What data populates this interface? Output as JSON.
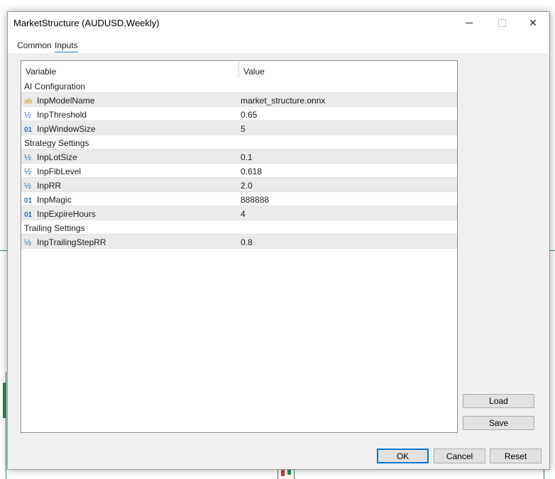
{
  "window": {
    "title": "MarketStructure (AUDUSD,Weekly)",
    "minimize_glyph": "—",
    "maximize_glyph": "□",
    "close_glyph": "✕"
  },
  "tabs": [
    {
      "label": "Common",
      "active": false
    },
    {
      "label": "Inputs",
      "active": true
    }
  ],
  "grid": {
    "headers": {
      "variable": "Variable",
      "value": "Value"
    },
    "rows": [
      {
        "kind": "section",
        "variable": "AI Configuration",
        "value": ""
      },
      {
        "kind": "param",
        "type_icon": "ab",
        "icon_name": "string-type-icon",
        "variable": "InpModelName",
        "value": "market_structure.onnx"
      },
      {
        "kind": "param",
        "type_icon": "½",
        "icon_name": "double-type-icon",
        "variable": "InpThreshold",
        "value": "0.65"
      },
      {
        "kind": "param",
        "type_icon": "01",
        "icon_name": "integer-type-icon",
        "variable": "InpWindowSize",
        "value": "5"
      },
      {
        "kind": "section",
        "variable": "Strategy Settings",
        "value": ""
      },
      {
        "kind": "param",
        "type_icon": "½",
        "icon_name": "double-type-icon",
        "variable": "InpLotSize",
        "value": "0.1"
      },
      {
        "kind": "param",
        "type_icon": "½",
        "icon_name": "double-type-icon",
        "variable": "InpFibLevel",
        "value": "0.618"
      },
      {
        "kind": "param",
        "type_icon": "½",
        "icon_name": "double-type-icon",
        "variable": "InpRR",
        "value": "2.0"
      },
      {
        "kind": "param",
        "type_icon": "01",
        "icon_name": "integer-type-icon",
        "variable": "InpMagic",
        "value": "888888"
      },
      {
        "kind": "param",
        "type_icon": "01",
        "icon_name": "integer-type-icon",
        "variable": "InpExpireHours",
        "value": "4"
      },
      {
        "kind": "section",
        "variable": "Trailing Settings",
        "value": ""
      },
      {
        "kind": "param",
        "type_icon": "½",
        "icon_name": "double-type-icon",
        "variable": "InpTrailingStepRR",
        "value": "0.8"
      }
    ]
  },
  "side_buttons": {
    "load": "Load",
    "save": "Save"
  },
  "footer": {
    "ok": "OK",
    "cancel": "Cancel",
    "reset": "Reset"
  },
  "colors": {
    "accent": "#0078d7",
    "row_shade": "#ebebeb",
    "type_icon_blue": "#2a6fb0",
    "type_icon_gold": "#c8a000"
  }
}
